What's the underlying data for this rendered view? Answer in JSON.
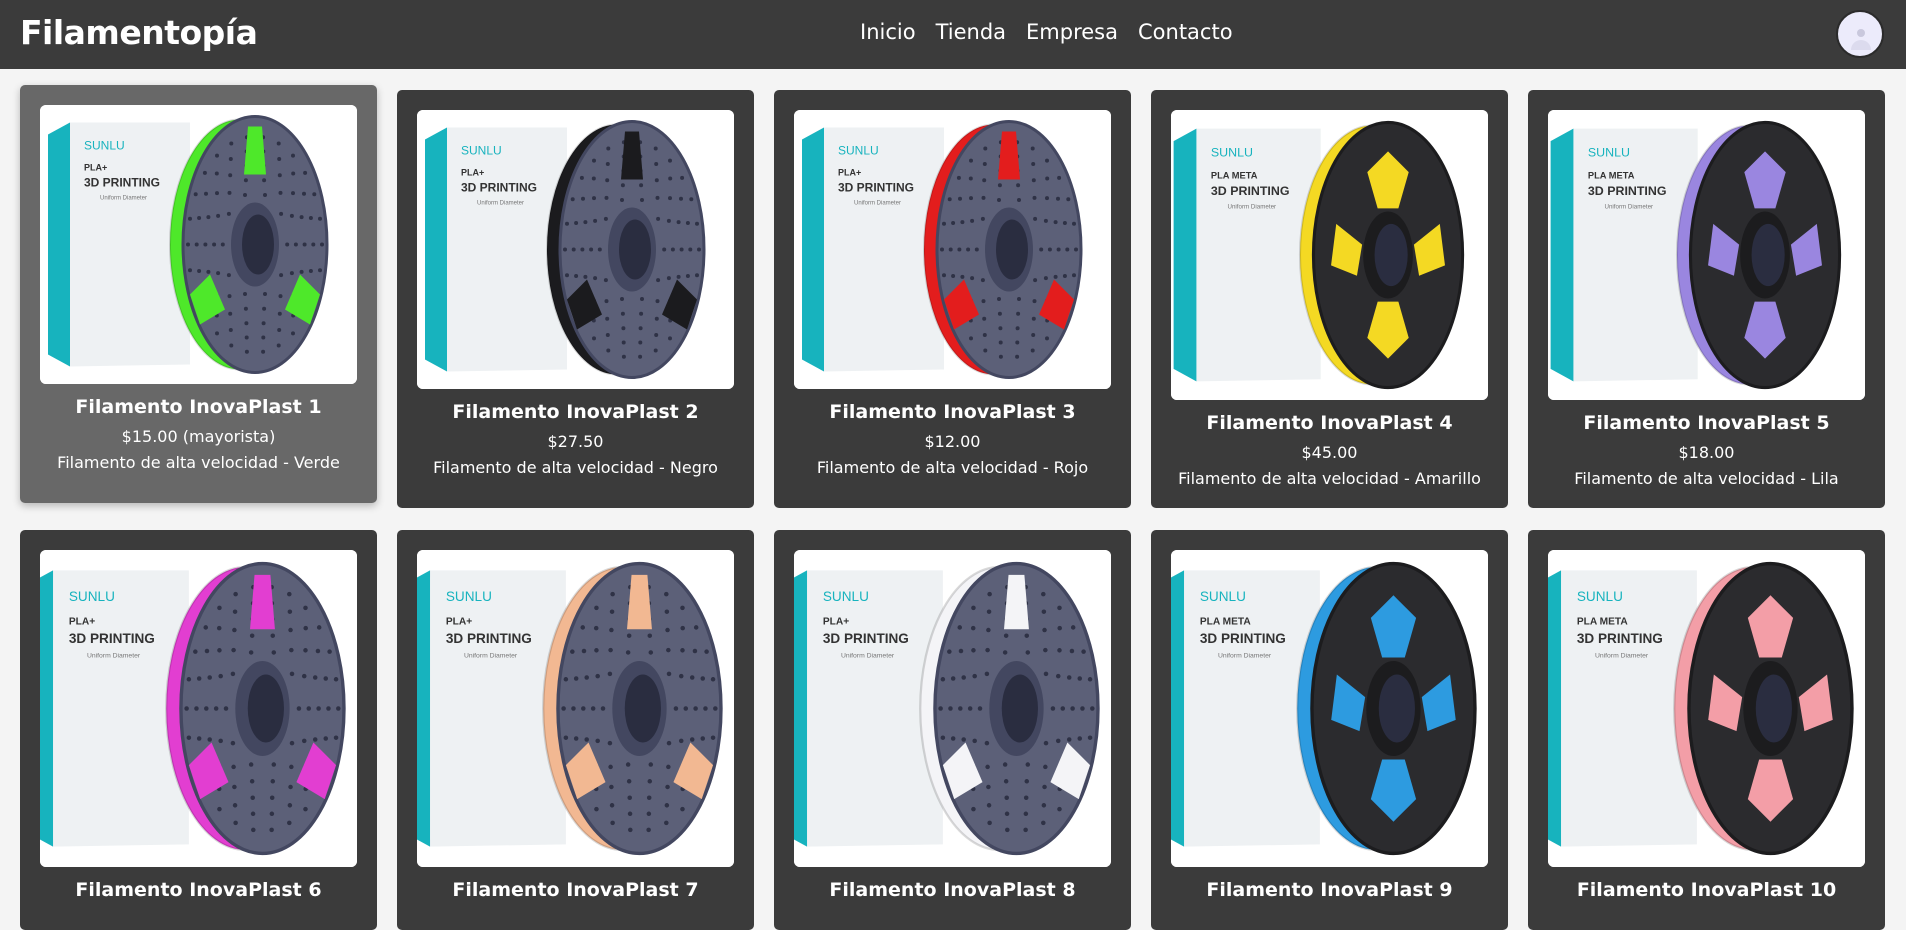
{
  "app": {
    "brand": "Filamentopía",
    "nav": [
      "Inicio",
      "Tienda",
      "Empresa",
      "Contacto"
    ],
    "avatar_icon": "user-avatar-icon"
  },
  "products": [
    {
      "title": "Filamento InovaPlast 1",
      "price": "$15.00 (mayorista)",
      "desc": "Filamento de alta velocidad - Verde",
      "color": "#4ee82a",
      "box": "PLA+",
      "style": "A"
    },
    {
      "title": "Filamento InovaPlast 2",
      "price": "$27.50",
      "desc": "Filamento de alta velocidad - Negro",
      "color": "#1b1b1e",
      "box": "PLA+",
      "style": "A"
    },
    {
      "title": "Filamento InovaPlast 3",
      "price": "$12.00",
      "desc": "Filamento de alta velocidad - Rojo",
      "color": "#e31d1d",
      "box": "PLA+",
      "style": "A"
    },
    {
      "title": "Filamento InovaPlast 4",
      "price": "$45.00",
      "desc": "Filamento de alta velocidad - Amarillo",
      "color": "#f4d923",
      "box": "PLA META",
      "style": "B"
    },
    {
      "title": "Filamento InovaPlast 5",
      "price": "$18.00",
      "desc": "Filamento de alta velocidad - Lila",
      "color": "#9a86e0",
      "box": "PLA META",
      "style": "B"
    },
    {
      "title": "Filamento InovaPlast 6",
      "price": "",
      "desc": "",
      "color": "#e23ed1",
      "box": "PLA+",
      "style": "A"
    },
    {
      "title": "Filamento InovaPlast 7",
      "price": "",
      "desc": "",
      "color": "#f2b892",
      "box": "PLA+",
      "style": "A"
    },
    {
      "title": "Filamento InovaPlast 8",
      "price": "",
      "desc": "",
      "color": "#f4f4f7",
      "box": "PLA+",
      "style": "A"
    },
    {
      "title": "Filamento InovaPlast 9",
      "price": "",
      "desc": "",
      "color": "#2d9be0",
      "box": "PLA META",
      "style": "B"
    },
    {
      "title": "Filamento InovaPlast 10",
      "price": "",
      "desc": "",
      "color": "#f39ea7",
      "box": "PLA META",
      "style": "B"
    }
  ],
  "image_brand": "SUNLU",
  "image_box_line2": "3D PRINTING",
  "image_box_line3": "Uniform Diameter",
  "colors": {
    "topbar": "#3b3b3b",
    "card": "#3b3b3b",
    "card_hover": "#686868",
    "box_teal": "#17b3be"
  }
}
